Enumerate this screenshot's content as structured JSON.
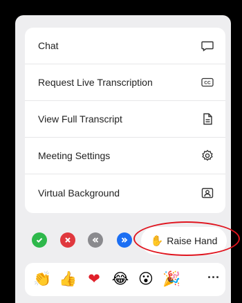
{
  "menu": {
    "items": [
      {
        "label": "Chat",
        "icon": "chat-bubble-icon"
      },
      {
        "label": "Request Live Transcription",
        "icon": "closed-caption-icon"
      },
      {
        "label": "View Full Transcript",
        "icon": "document-icon"
      },
      {
        "label": "Meeting Settings",
        "icon": "gear-icon"
      },
      {
        "label": "Virtual Background",
        "icon": "person-portrait-icon"
      }
    ],
    "cc_text": "CC"
  },
  "reactions": {
    "status_buttons": [
      {
        "name": "yes-button",
        "icon": "check-icon",
        "color": "#2eb84b"
      },
      {
        "name": "no-button",
        "icon": "x-icon",
        "color": "#e0383e"
      },
      {
        "name": "slower-button",
        "icon": "double-left-chevron-icon",
        "color": "#8a8a8e"
      },
      {
        "name": "faster-button",
        "icon": "double-right-chevron-icon",
        "color": "#1b6ef3"
      }
    ],
    "raise_hand": {
      "label": "Raise Hand",
      "icon": "✋"
    }
  },
  "emojis": {
    "items": [
      "👏",
      "👍",
      "❤",
      "😂",
      "😮",
      "🎉"
    ],
    "more_label": "···"
  },
  "highlight_color": "#e0141e"
}
